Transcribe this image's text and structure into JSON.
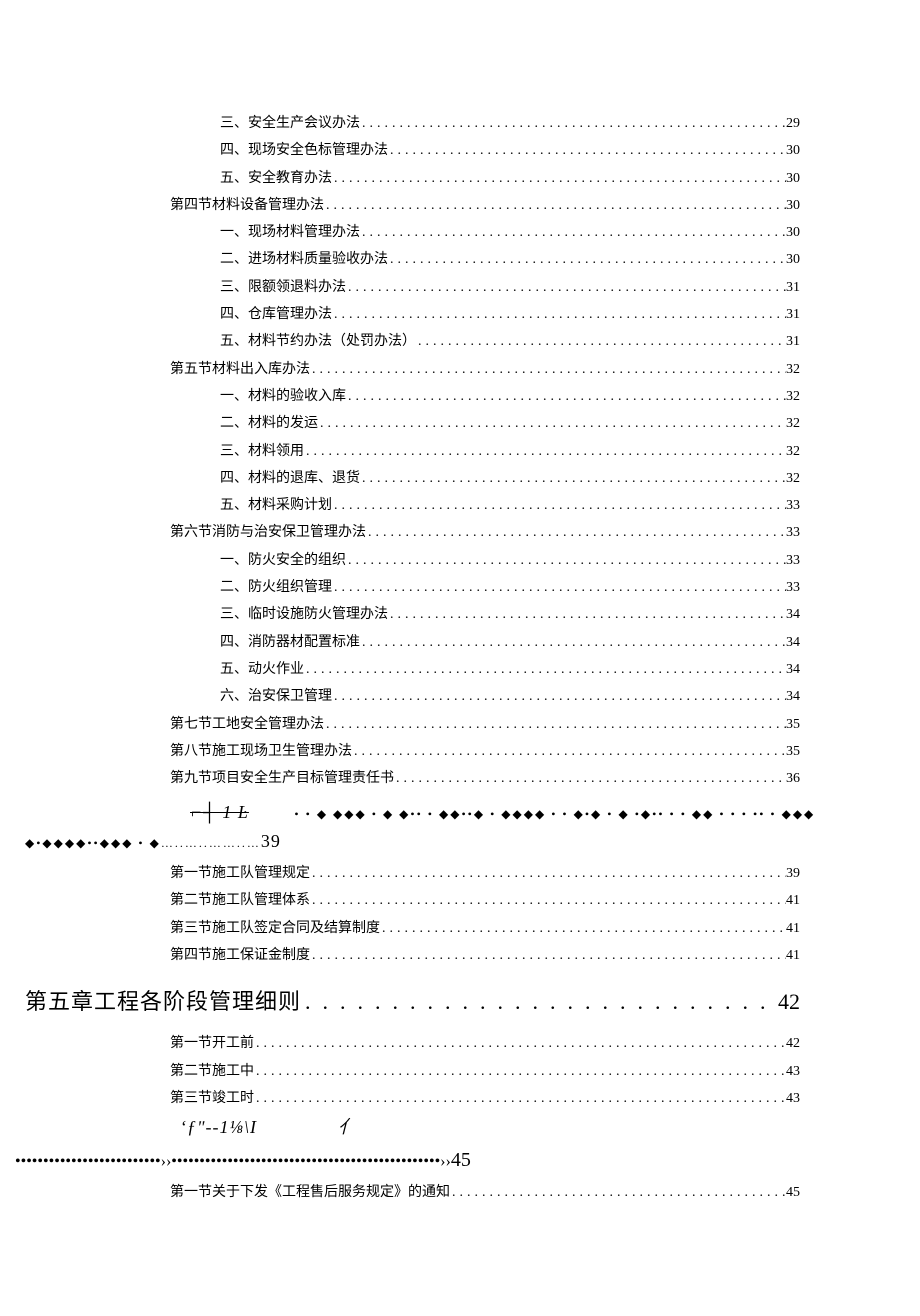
{
  "toc": [
    {
      "level": 2,
      "label": "三、安全生产会议办法",
      "page": "29"
    },
    {
      "level": 2,
      "label": "四、现场安全色标管理办法",
      "page": "30"
    },
    {
      "level": 2,
      "label": "五、安全教育办法",
      "page": "30"
    },
    {
      "level": 1,
      "label": "第四节材料设备管理办法",
      "page": "30"
    },
    {
      "level": 2,
      "label": "一、现场材料管理办法",
      "page": "30"
    },
    {
      "level": 2,
      "label": "二、进场材料质量验收办法",
      "page": "30"
    },
    {
      "level": 2,
      "label": "三、限额领退料办法",
      "page": "31"
    },
    {
      "level": 2,
      "label": "四、仓库管理办法",
      "page": "31"
    },
    {
      "level": 2,
      "label": "五、材料节约办法（处罚办法）",
      "page": "31"
    },
    {
      "level": 1,
      "label": "第五节材料出入库办法",
      "page": "32"
    },
    {
      "level": 2,
      "label": "一、材料的验收入库",
      "page": "32"
    },
    {
      "level": 2,
      "label": "二、材料的发运",
      "page": "32"
    },
    {
      "level": 2,
      "label": "三、材料领用",
      "page": "32"
    },
    {
      "level": 2,
      "label": "四、材料的退库、退货",
      "page": "32"
    },
    {
      "level": 2,
      "label": "五、材料采购计划",
      "page": "33"
    },
    {
      "level": 1,
      "label": "第六节消防与治安保卫管理办法",
      "page": "33"
    },
    {
      "level": 2,
      "label": "一、防火安全的组织",
      "page": "33"
    },
    {
      "level": 2,
      "label": "二、防火组织管理",
      "page": "33"
    },
    {
      "level": 2,
      "label": "三、临时设施防火管理办法",
      "page": "34"
    },
    {
      "level": 2,
      "label": "四、消防器材配置标准",
      "page": "34"
    },
    {
      "level": 2,
      "label": "五、动火作业",
      "page": "34"
    },
    {
      "level": 2,
      "label": "六、治安保卫管理",
      "page": "34"
    },
    {
      "level": 1,
      "label": "第七节工地安全管理办法",
      "page": "35"
    },
    {
      "level": 1,
      "label": "第八节施工现场卫生管理办法",
      "page": "35"
    },
    {
      "level": 1,
      "label": "第九节项目安全生产目标管理责任书",
      "page": "36"
    }
  ],
  "decor_top": {
    "prefix": "⌐┤  1    Ŀ",
    "diamonds": "• •  ◆ ◆◆◆ •  ◆  ◆•• •  ◆◆••◆ • ◆◆◆◆ •   • ◆•◆ •  ◆ •◆•• •   • ◆◆  •  • •  •• •  ◆◆◆◆•◆◆◆◆••◆◆◆ •  ◆…..…..……..…",
    "page": "39"
  },
  "toc2": [
    {
      "level": 1,
      "label": "第一节施工队管理规定",
      "page": "39"
    },
    {
      "level": 1,
      "label": "第二节施工队管理体系",
      "page": "41"
    },
    {
      "level": 1,
      "label": "第三节施工队签定合同及结算制度",
      "page": "41"
    },
    {
      "level": 1,
      "label": "第四节施工保证金制度",
      "page": "41"
    }
  ],
  "chapter5": {
    "label": "第五章工程各阶段管理细则",
    "page": "42"
  },
  "toc3": [
    {
      "level": 1,
      "label": "第一节开工前",
      "page": "42"
    },
    {
      "level": 1,
      "label": "第二节施工中",
      "page": "43"
    },
    {
      "level": 1,
      "label": "第三节竣工时",
      "page": "43"
    }
  ],
  "decor_bottom": {
    "line1_a": "ʻƒʺ--1⅛\\I",
    "line1_b": "亻",
    "dots1": "••••••••••••••••••••••••••",
    "chev": "››",
    "dots2": "••••••••••••••••••••••••••••••••••••••••••••••••",
    "page": "45"
  },
  "toc4": [
    {
      "level": 1,
      "label": "第一节关于下发《工程售后服务规定》的通知",
      "page": "45"
    }
  ]
}
